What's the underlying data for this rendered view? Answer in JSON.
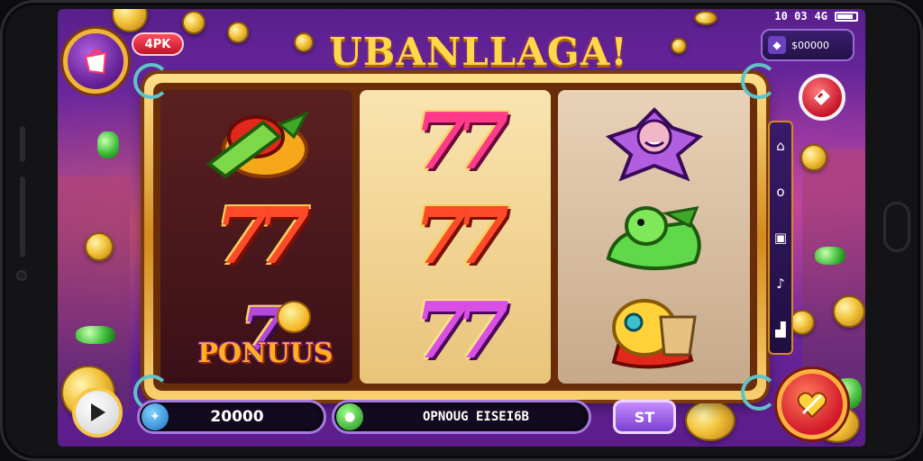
{
  "status_bar": {
    "time": "10 03",
    "network": "4G"
  },
  "header": {
    "title": "UBANLLAGA!",
    "tag": "4PK",
    "balance": "$00000"
  },
  "reels": [
    {
      "symbols": [
        "fruit-bonus",
        "seven-orange",
        "seven-bonus"
      ],
      "bonus_label": "PONUUS"
    },
    {
      "symbols": [
        "seven-red",
        "seven-red",
        "seven-pink"
      ]
    },
    {
      "symbols": [
        "purple-character",
        "green-character",
        "yellow-basket"
      ]
    }
  ],
  "seven_glyph": "77",
  "right_rail": {
    "icons": [
      "home-icon",
      "info-icon",
      "lock-icon",
      "music-icon",
      "chart-icon"
    ]
  },
  "bottom": {
    "bet_value": "20000",
    "message": "OPNOUG EISEI6B",
    "spin_label": "ST"
  },
  "colors": {
    "accent": "#ffd84a",
    "frame": "#d48a1e",
    "background": "#6a2aa0"
  }
}
